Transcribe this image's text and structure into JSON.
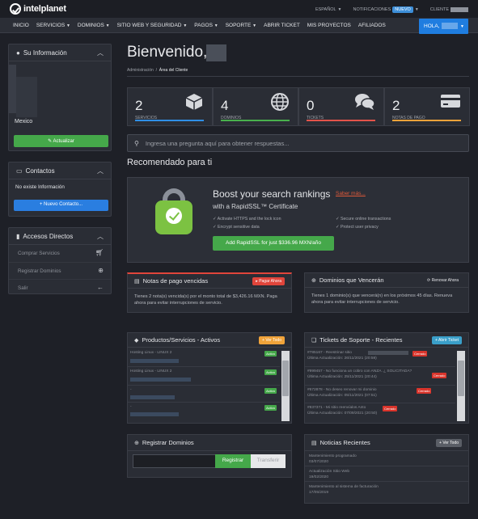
{
  "brand": {
    "name": "intelplanet"
  },
  "topbar": {
    "language": "ESPAÑOL",
    "notifications_label": "NOTIFICACIONES",
    "notifications_badge": "NUEVO",
    "client_label": "CLIENTE"
  },
  "nav": {
    "items": [
      "INICIO",
      "SERVICIOS",
      "DOMINIOS",
      "SITIO WEB Y SEGURIDAD",
      "PAGOS",
      "SOPORTE",
      "ABRIR TICKET",
      "MIS PROYECTOS",
      "AFILIADOS"
    ],
    "hola": "HOLA,"
  },
  "sidebar": {
    "info": {
      "title": "Su Información",
      "country": "Mexico",
      "button": "Actualizar"
    },
    "contacts": {
      "title": "Contactos",
      "empty": "No existe Información",
      "button": "+ Nuevo Contacto..."
    },
    "shortcuts": {
      "title": "Accesos Directos",
      "items": [
        {
          "label": "Comprar Servicios",
          "icon": "cart-icon"
        },
        {
          "label": "Registrar Dominios",
          "icon": "globe-icon"
        },
        {
          "label": "Salir",
          "icon": "arrow-left-icon"
        }
      ]
    }
  },
  "main": {
    "welcome": "Bienvenido,",
    "breadcrumb": {
      "home": "Administración",
      "sep": "/",
      "current": "Área del Cliente"
    },
    "stats": [
      {
        "count": "2",
        "label": "SERVICIOS",
        "icon": "box-icon",
        "color": "#2f8fe6"
      },
      {
        "count": "4",
        "label": "DOMINIOS",
        "icon": "globe-icon",
        "color": "#49b04d"
      },
      {
        "count": "0",
        "label": "TICKETS",
        "icon": "comments-icon",
        "color": "#e3534a"
      },
      {
        "count": "2",
        "label": "NOTAS DE PAGO",
        "icon": "credit-card-icon",
        "color": "#f0a33a"
      }
    ],
    "search_placeholder": "Ingresa una pregunta aquí para obtener respuestas...",
    "recommended": "Recomendado para ti",
    "promo": {
      "title": "Boost your search rankings",
      "more": "Saber más...",
      "subtitle": "with a RapidSSL™ Certificate",
      "features": [
        "Activate HTTPS and the lock icon",
        "Encrypt sensitive data",
        "Secure online transactions",
        "Protect user privacy"
      ],
      "button": "Add RapidSSL for just $336.96 MXN/año"
    },
    "overdue": {
      "title": "Notas de pago vencidas",
      "button": "Pagar Ahora",
      "text": "Tienes 2 nota(s) vencida(s) por el monto total de $3,426.16 MXN. Paga ahora para evitar interrupciones de servicio."
    },
    "expiring": {
      "title": "Dominios que Vencerán",
      "button": "Renovar Ahora",
      "text": "Tienes 1 dominio(s) que vencerá(n) en los próximos 45 días. Renueva ahora para evitar interrupciones de servicio."
    },
    "products": {
      "title": "Productos/Servicios - Activos",
      "button": "Ver Todo",
      "rows": [
        {
          "name": "Hosting Linux - LINUX 2",
          "status": "Activo"
        },
        {
          "name": "Hosting Linux - LINUX 2",
          "status": "Activo"
        },
        {
          "name": "-",
          "status": "Activo"
        },
        {
          "name": "-",
          "status": "Activo"
        }
      ]
    },
    "tickets": {
      "title": "Tickets de Soporte - Recientes",
      "button": "Abrir Ticket",
      "rows": [
        {
          "subject": "#785167 - Reestrinar sitio",
          "updated": "Última Actualización: 26/11/2021 (20:59)",
          "status": "Cerrado"
        },
        {
          "subject": "#999457 - No funciona un cobro con ANZA. ¿ SOLICITADA?",
          "updated": "Última Actualización: 25/11/2021 (20:44)",
          "status": "Cerrado"
        },
        {
          "subject": "#672878 - No deseo renovar mi dominio",
          "updated": "Última Actualización: 05/11/2021 (07:51)",
          "status": "Cerrado"
        },
        {
          "subject": "#837371 - Mi sitio reenvíalos Anto",
          "updated": "Última Actualización: 07/09/2021 (20:50)",
          "status": "Cerrado"
        }
      ]
    },
    "register": {
      "title": "Registrar Dominios",
      "register_btn": "Registrar",
      "transfer_btn": "Transferir"
    },
    "news": {
      "title": "Noticias Recientes",
      "button": "Ver Todo",
      "rows": [
        {
          "title": "Mantenimiento programado",
          "date": "03/07/2020"
        },
        {
          "title": "Actualización Sitio Web",
          "date": "19/02/2020"
        },
        {
          "title": "Mantenimiento al sistema de facturación",
          "date": "17/05/2019"
        }
      ]
    }
  }
}
